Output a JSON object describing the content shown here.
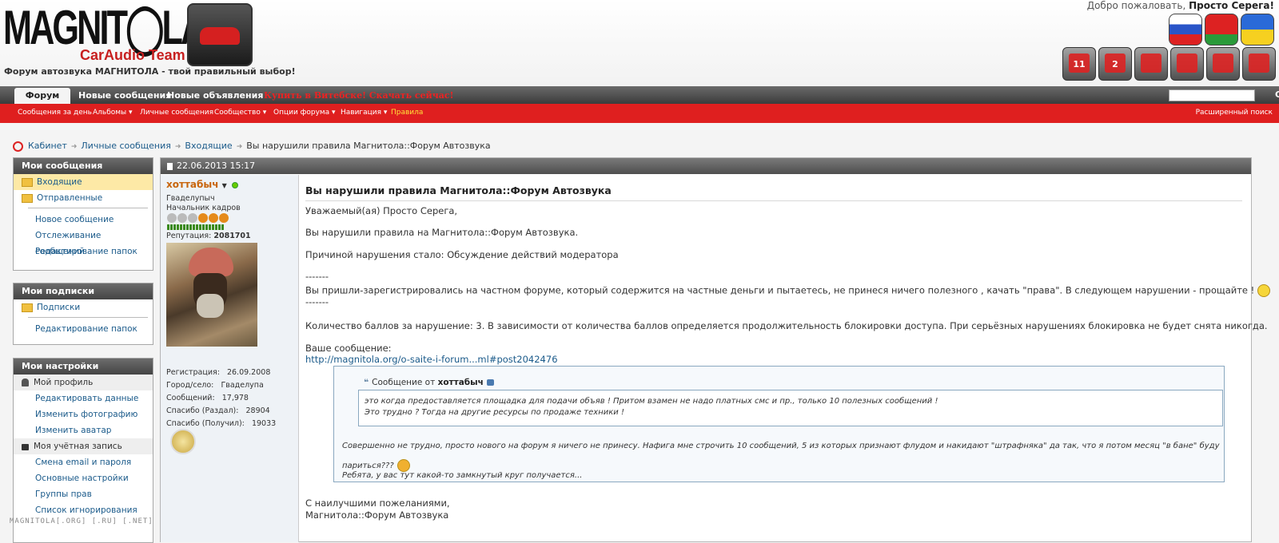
{
  "header": {
    "logo_text": "MAGNIT◯LA",
    "logo_sub": "CarAudio Team",
    "tagline": "Форум автозвука МАГНИТОЛА - твой правильный выбор!",
    "welcome_prefix": "Добро пожаловать,",
    "welcome_user": "Просто Серега!",
    "flags": [
      "ru-flag-icon",
      "by-flag-icon",
      "ua-flag-icon"
    ],
    "toolbar_buttons": [
      {
        "icon": "notifications-icon",
        "badge": "11"
      },
      {
        "icon": "cart-icon",
        "badge": "2"
      },
      {
        "icon": "save-icon",
        "badge": ""
      },
      {
        "icon": "mail-icon",
        "badge": ""
      },
      {
        "icon": "profile-icon",
        "badge": ""
      },
      {
        "icon": "logout-icon",
        "badge": ""
      }
    ]
  },
  "nav": {
    "tabs": [
      "Форум",
      "Новые сообщения",
      "Новые объявления"
    ],
    "promo": "Купить в Витебске! Скачать сейчас!",
    "search_go": "С"
  },
  "subnav": {
    "items": [
      "Сообщения за день",
      "Альбомы ▾",
      "Личные сообщения",
      "Сообщество ▾",
      "Опции форума ▾",
      "Навигация ▾",
      "Правила"
    ],
    "advanced_search": "Расширенный поиск"
  },
  "breadcrumb": {
    "items": [
      "Кабинет",
      "Личные сообщения",
      "Входящие"
    ],
    "current": "Вы нарушили правила Магнитола::Форум Автозвука"
  },
  "sidebar": {
    "messages": {
      "title": "Мои сообщения",
      "folders": [
        "Входящие",
        "Отправленные"
      ],
      "links": [
        "Новое сообщение",
        "Отслеживание сообщений",
        "Редактирование папок"
      ]
    },
    "subscriptions": {
      "title": "Мои подписки",
      "folders": [
        "Подписки"
      ],
      "links": [
        "Редактирование папок"
      ]
    },
    "settings": {
      "title": "Мои настройки",
      "profile": "Мой профиль",
      "profile_links": [
        "Редактировать данные",
        "Изменить фотографию",
        "Изменить аватар"
      ],
      "account": "Моя учётная запись",
      "account_links": [
        "Смена email и пароля",
        "Основные настройки",
        "Группы прав",
        "Список игнорирования"
      ]
    }
  },
  "post": {
    "date": "22.06.2013 15:17",
    "user": {
      "name": "хоттабыч",
      "city_title": "Гваделупыч",
      "rank": "Начальник кадров",
      "reputation_label": "Репутация:",
      "reputation_value": "2081701",
      "stats": [
        [
          "Регистрация:",
          "26.09.2008"
        ],
        [
          "Город/село:",
          "Гваделупа"
        ],
        [
          "Сообщений:",
          "17,978"
        ],
        [
          "Спасибо (Раздал):",
          "28904"
        ],
        [
          "Спасибо (Получил):",
          "19033"
        ]
      ]
    },
    "title": "Вы нарушили правила Магнитола::Форум Автозвука",
    "lines": [
      "Уважаемый(ая) Просто Серега,",
      "Вы нарушили правила на Магнитола::Форум Автозвука.",
      "Причиной нарушения стало: Обсуждение действий модератора",
      "-------",
      "Вы пришли-зарегистрировались на частном форуме, который содержится на частные деньги и пытаетесь, не принеся ничего полезного , качать \"права\". В следующем нарушении - прощайте !",
      "-------",
      "Количество баллов за нарушение: 3. В зависимости от количества баллов определяется продолжительность блокировки доступа. При серьёзных нарушениях блокировка не будет снята никогда.",
      "Ваше сообщение:",
      "http://magnitola.org/o-saite-i-forum...ml#post2042476"
    ],
    "quote": {
      "head_prefix": "Сообщение от",
      "author": "хоттабыч",
      "inner": [
        "это когда предоставляется площадка для подачи объяв ! Притом взамен не надо платных смс и пр., только 10 полезных сообщений !",
        "Это трудно ? Тогда на другие ресурсы по продаже техники !"
      ],
      "body": [
        "Совершенно не трудно, просто нового на форум я ничего не принесу. Нафига мне строчить 10 сообщений, 5 из которых признают флудом и накидают \"штрафняка\" да так, что я потом месяц \"в бане\" буду",
        "париться???",
        "Ребята, у вас тут какой-то замкнутый круг получается..."
      ]
    },
    "signoff": [
      "С наилучшими пожеланиями,",
      "Магнитола::Форум Автозвука"
    ]
  },
  "watermark": "MAGNITOLA[.ORG] [.RU] [.NET]"
}
